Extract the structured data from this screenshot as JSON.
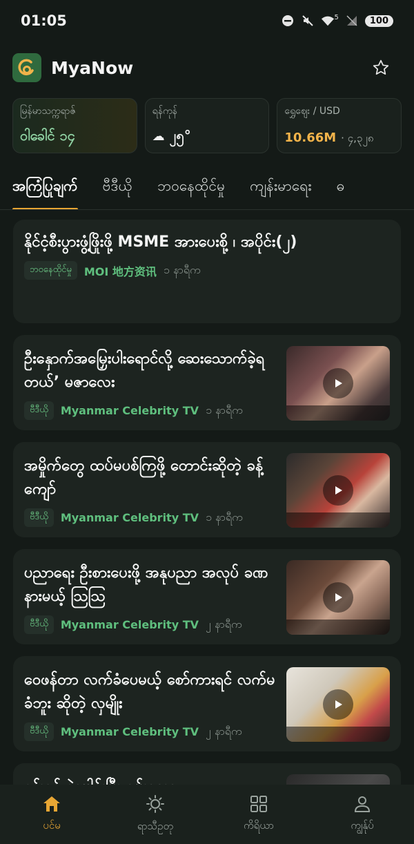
{
  "status": {
    "time": "01:05",
    "battery": "100",
    "signal_label": "5"
  },
  "header": {
    "title": "MyaNow"
  },
  "widgets": [
    {
      "label": "မြန်မာသက္ကရာဇ်",
      "value": "ဝါခေါင် ၁၄"
    },
    {
      "label": "ရန်ကုန်",
      "icon": "cloud-icon",
      "value": "၂၅°"
    },
    {
      "label": "ရွှေဈေး / USD",
      "value": "10.66M",
      "sub": "· ၄,၃၂၈"
    }
  ],
  "tabs": [
    {
      "label": "အကြံပြုချက်",
      "active": true
    },
    {
      "label": "ဗီဒီယို"
    },
    {
      "label": "ဘဝနေထိုင်မှု"
    },
    {
      "label": "ကျန်းမာရေး"
    },
    {
      "label": "ဓ"
    }
  ],
  "feed": [
    {
      "title": "နိုင်ငံ့စီးပွားဖွံ့ဖြိုးဖို့ MSME အားပေးစို့ ၊ အပိုင်း(၂)",
      "tag": "ဘဝနေထိုင်မှု",
      "source": "MOI 地方资讯",
      "time": "၁ နာရီက"
    },
    {
      "title": "ဦးနှောက်အမြှေးပါးရောင်လို့ ဆေးသောက်ခဲ့ရတယ်’ မဇာလေး",
      "tag": "ဗီဒီယို",
      "source": "Myanmar Celebrity TV",
      "time": "၁ နာရီက"
    },
    {
      "title": "အမှိုက်တွေ ထပ်မပစ်ကြဖို့ တောင်းဆိုတဲ့ ခန့်ကျော်",
      "tag": "ဗီဒီယို",
      "source": "Myanmar Celebrity TV",
      "time": "၁ နာရီက"
    },
    {
      "title": "ပညာရေး ဦးစားပေးဖို့ အနုပညာ အလုပ် ခဏနားမယ့် ဩဩ",
      "tag": "ဗီဒီယို",
      "source": "Myanmar Celebrity TV",
      "time": "၂ နာရီက"
    },
    {
      "title": "ဝေဖန်တာ လက်ခံပေမယ့် စော်ကားရင် လက်မခံဘူး ဆိုတဲ့ လှမျိုး",
      "tag": "ဗီဒီယို",
      "source": "Myanmar Celebrity TV",
      "time": "၂ နာရီက"
    },
    {
      "title": "နန်းခင် နဲ့ပေါင်းပြီး ရှမ်းကော"
    }
  ],
  "nav": [
    {
      "label": "ပင်မ",
      "icon": "home-icon",
      "active": true
    },
    {
      "label": "ရာသီဥတု",
      "icon": "sun-icon"
    },
    {
      "label": "ကိရိယာ",
      "icon": "grid-icon"
    },
    {
      "label": "ကျွန်ုပ်",
      "icon": "person-icon"
    }
  ],
  "colors": {
    "accent": "#e8a634",
    "source_green": "#5fbf7e",
    "background": "#141a17",
    "card": "#1d2420"
  }
}
